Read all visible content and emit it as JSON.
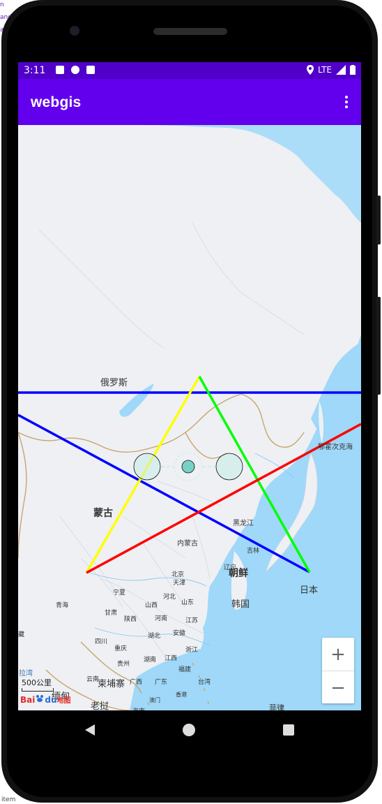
{
  "background_text": [
    "n",
    "and",
    "ai",
    "item"
  ],
  "status_bar": {
    "time": "3:11",
    "network": "LTE"
  },
  "app_bar": {
    "title": "webgis"
  },
  "map": {
    "labels": {
      "russia": "俄罗斯",
      "mongolia": "蒙古",
      "japan": "日本",
      "north_korea": "朝鲜",
      "south_korea": "韩国",
      "myanmar": "缅甸",
      "laos": "老挝",
      "thailand": "泰国",
      "cambodia": "柬埔寨",
      "okhotsk_sea": "鄂霍次克海",
      "heilongjiang": "黑龙江",
      "jilin": "吉林",
      "liaoning": "辽宁",
      "inner_mongolia": "内蒙古",
      "qinghai": "青海",
      "gansu": "甘肃",
      "shaanxi": "陕西",
      "shanxi": "山西",
      "henan": "河南",
      "hubei": "湖北",
      "sichuan": "四川",
      "guizhou": "贵州",
      "hunan": "湖南",
      "jiangxi": "江西",
      "yunnan": "云南",
      "guangxi": "广西",
      "guangdong": "广东",
      "fujian": "福建",
      "zhejiang": "浙江",
      "anhui": "安徽",
      "jiangsu": "江苏",
      "shandong": "山东",
      "hebei": "河北",
      "beijing": "北京",
      "tianjin": "天津",
      "ningxia": "宁夏",
      "chongqing": "重庆",
      "taiwan": "台湾",
      "hainan": "海南",
      "hongkong": "香港",
      "macau": "澳门",
      "tibet_edge": "藏",
      "partial_bottom": "菲律"
    },
    "scale": {
      "label": "500公里",
      "edge_text": "拉湾"
    },
    "logo": {
      "brand": "Bai",
      "suffix": "du",
      "map": "地图"
    },
    "zoom": {
      "in": "+",
      "out": "−"
    },
    "overlay_colors": {
      "blue": "#0000ff",
      "yellow": "#ffff00",
      "green": "#00ff00",
      "red": "#ff0000"
    }
  }
}
